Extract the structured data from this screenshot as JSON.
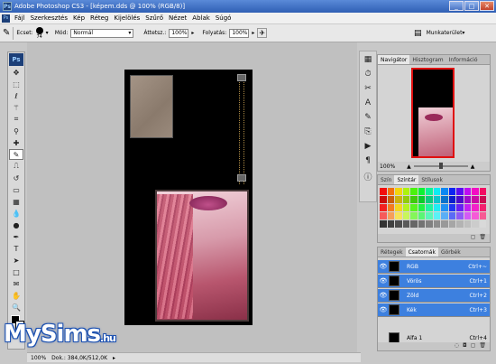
{
  "titlebar": {
    "app_icon": "Ps",
    "title": "Adobe Photoshop CS3 - [képem.dds @ 100% (RGB/8)]",
    "min": "_",
    "max": "□",
    "close": "✕"
  },
  "menu": {
    "items": [
      "Fájl",
      "Szerkesztés",
      "Kép",
      "Réteg",
      "Kijelölés",
      "Szűrő",
      "Nézet",
      "Ablak",
      "Súgó"
    ]
  },
  "options": {
    "brush_label": "Ecset:",
    "brush_size": "74",
    "mode_label": "Mód:",
    "mode_value": "Normál",
    "opacity_label": "Áttetsz.:",
    "opacity_value": "100%",
    "flow_label": "Folyatás:",
    "flow_value": "100%",
    "workspace_label": "Munkaterület"
  },
  "toolbox": {
    "logo": "Ps"
  },
  "status": {
    "zoom": "100%",
    "doc_info": "Dok.: 384,0K/512,0K"
  },
  "logo": {
    "text": "MySims",
    "suffix": ".hu"
  },
  "navigator": {
    "tabs": [
      "Navigátor",
      "Hisztogram",
      "Információ"
    ],
    "zoom": "100%"
  },
  "color_panel": {
    "tabs": [
      "Szín",
      "Színtár",
      "Stílusok"
    ]
  },
  "layers_panel": {
    "tabs": [
      "Rétegek",
      "Csatornák",
      "Görbék"
    ],
    "channels": [
      {
        "name": "RGB",
        "shortcut": "Ctrl+~",
        "selected": true
      },
      {
        "name": "Vörös",
        "shortcut": "Ctrl+1",
        "selected": true
      },
      {
        "name": "Zöld",
        "shortcut": "Ctrl+2",
        "selected": true
      },
      {
        "name": "Kék",
        "shortcut": "Ctrl+3",
        "selected": true
      },
      {
        "name": "Alfa 1",
        "shortcut": "Ctrl+4",
        "selected": false
      }
    ]
  }
}
